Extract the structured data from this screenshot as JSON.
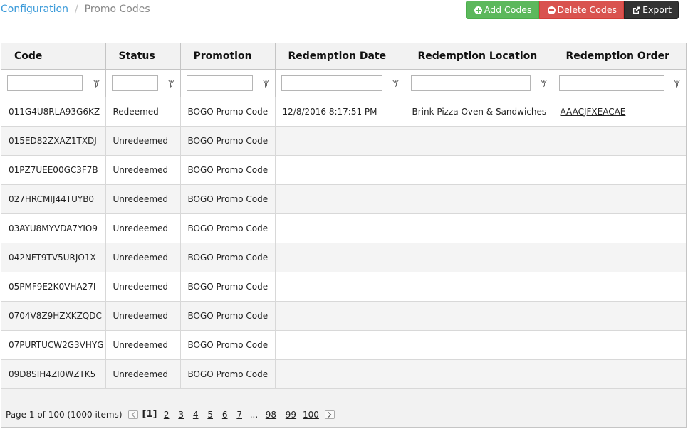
{
  "breadcrumb": {
    "root": "Configuration",
    "current": "Promo Codes"
  },
  "toolbar": {
    "add_label": "Add Codes",
    "delete_label": "Delete Codes",
    "export_label": "Export"
  },
  "colors": {
    "link": "#3a9ad9",
    "add": "#5cb85c",
    "delete": "#d9534f",
    "export": "#333333",
    "header_bg": "#f2f2f2"
  },
  "columns": [
    "Code",
    "Status",
    "Promotion",
    "Redemption Date",
    "Redemption Location",
    "Redemption Order"
  ],
  "rows": [
    {
      "code": "011G4U8RLA93G6KZ",
      "status": "Redeemed",
      "promotion": "BOGO Promo Code",
      "date": "12/8/2016 8:17:51 PM",
      "location": "Brink Pizza Oven & Sandwiches",
      "order": "AAACJFXEACAE"
    },
    {
      "code": "015ED82ZXAZ1TXDJ",
      "status": "Unredeemed",
      "promotion": "BOGO Promo Code",
      "date": "",
      "location": "",
      "order": ""
    },
    {
      "code": "01PZ7UEE00GC3F7B",
      "status": "Unredeemed",
      "promotion": "BOGO Promo Code",
      "date": "",
      "location": "",
      "order": ""
    },
    {
      "code": "027HRCMIJ44TUYB0",
      "status": "Unredeemed",
      "promotion": "BOGO Promo Code",
      "date": "",
      "location": "",
      "order": ""
    },
    {
      "code": "03AYU8MYVDA7YIO9",
      "status": "Unredeemed",
      "promotion": "BOGO Promo Code",
      "date": "",
      "location": "",
      "order": ""
    },
    {
      "code": "042NFT9TV5URJO1X",
      "status": "Unredeemed",
      "promotion": "BOGO Promo Code",
      "date": "",
      "location": "",
      "order": ""
    },
    {
      "code": "05PMF9E2K0VHA27I",
      "status": "Unredeemed",
      "promotion": "BOGO Promo Code",
      "date": "",
      "location": "",
      "order": ""
    },
    {
      "code": "0704V8Z9HZXKZQDC",
      "status": "Unredeemed",
      "promotion": "BOGO Promo Code",
      "date": "",
      "location": "",
      "order": ""
    },
    {
      "code": "07PURTUCW2G3VHYG",
      "status": "Unredeemed",
      "promotion": "BOGO Promo Code",
      "date": "",
      "location": "",
      "order": ""
    },
    {
      "code": "09D8SIH4ZI0WZTK5",
      "status": "Unredeemed",
      "promotion": "BOGO Promo Code",
      "date": "",
      "location": "",
      "order": ""
    }
  ],
  "pager": {
    "info": "Page 1 of 100 (1000 items)",
    "current": "[1]",
    "pages": [
      "2",
      "3",
      "4",
      "5",
      "6",
      "7",
      "...",
      "98",
      "99",
      "100"
    ]
  }
}
